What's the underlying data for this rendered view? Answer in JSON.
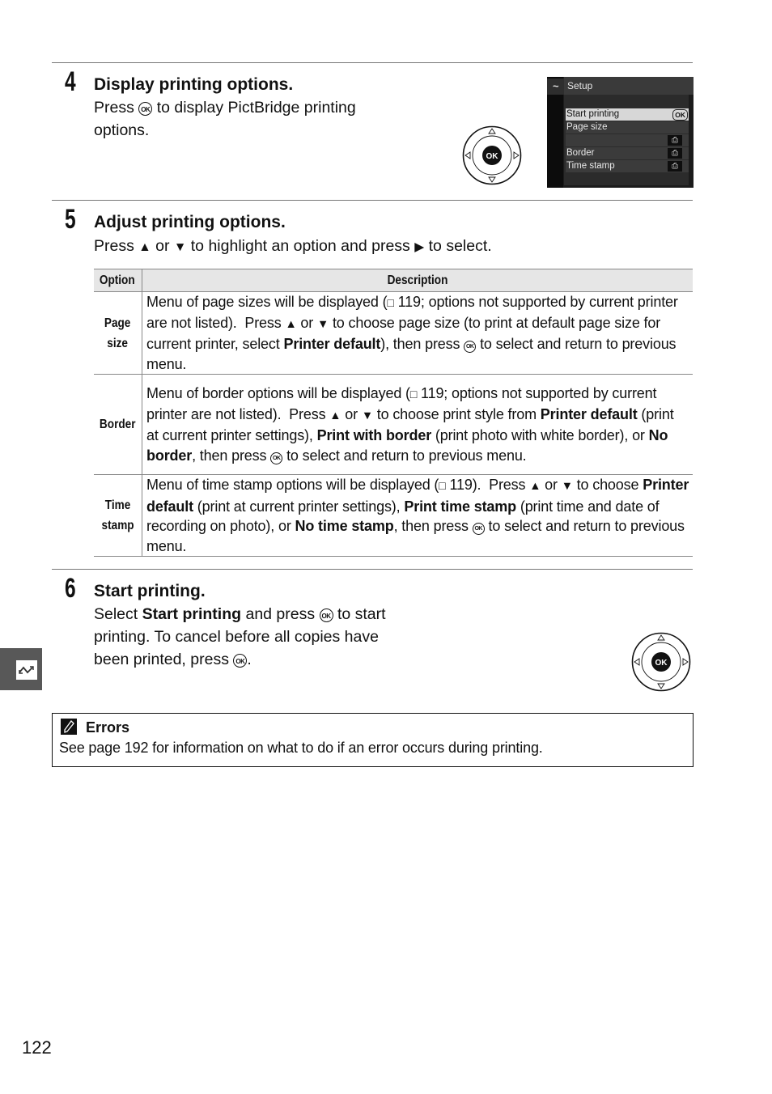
{
  "steps": [
    {
      "number": "4",
      "title": "Display printing options.",
      "body": {
        "pre": "Press",
        "ok": "OK",
        "post": "to display PictBridge printing",
        "line2": "options."
      }
    },
    {
      "number": "5",
      "title": "Adjust printing options.",
      "body": {
        "p1": "Press",
        "up": "▲",
        "p2": "or",
        "down": "▼",
        "p3": "to highlight an option and press",
        "right": "▶",
        "p4": "to select."
      }
    },
    {
      "number": "6",
      "title": "Start printing.",
      "body": {
        "l1_pre": "Select",
        "l1_bold": "Start printing",
        "l1_mid": "and press",
        "l1_post": "to start",
        "line2": "printing.  To cancel before all copies have",
        "l3_pre": "been printed, press",
        "l3_post": "."
      }
    }
  ],
  "camera_menu": {
    "header": "Setup",
    "tab_icon": "PictBridge",
    "items": [
      {
        "label": "Start printing",
        "value": "OK"
      },
      {
        "label": "Page size",
        "value": ""
      },
      {
        "label": "",
        "value": "printer-default"
      },
      {
        "label": "Border",
        "value": "printer-default"
      },
      {
        "label": "Time stamp",
        "value": "printer-default"
      }
    ]
  },
  "multi_selector": {
    "center_label": "OK"
  },
  "table": {
    "headers": [
      "Option",
      "Description"
    ],
    "rows": [
      {
        "option_l1": "Page",
        "option_l2": "size",
        "d": [
          "Menu of page sizes will be displayed (",
          "□",
          " 119; options not supported by current printer are not listed).  Press ",
          "▲",
          " or ",
          "▼",
          " to choose page size (to print at default page size for current printer, select ",
          "Printer default",
          "), then press ",
          "OK",
          " to select and return to previous menu."
        ]
      },
      {
        "option_l1": "Border",
        "option_l2": "",
        "d": [
          "Menu of border options will be displayed (",
          "□",
          " 119; options not supported by current printer are not listed).  Press ",
          "▲",
          " or ",
          "▼",
          " to choose print style from ",
          "Printer default",
          " (print at current printer settings), ",
          "Print with border",
          " (print photo with white border), or ",
          "No border",
          ", then press ",
          "OK",
          " to select and return to previous menu."
        ]
      },
      {
        "option_l1": "Time",
        "option_l2": "stamp",
        "d": [
          "Menu of time stamp options will be displayed (",
          "□",
          " 119).  Press ",
          "▲",
          " or ",
          "▼",
          " to choose ",
          "Printer default",
          " (print at current printer settings), ",
          "Print time stamp",
          " (print time and date of recording on photo), or ",
          "No time stamp",
          ", then press ",
          "OK",
          " to select and return to previous menu."
        ]
      }
    ]
  },
  "note": {
    "icon": "pencil-icon",
    "title": "Errors",
    "body": "See page 192 for information on what to do if an error occurs during printing."
  },
  "side_tab": {
    "icon": "connection-icon"
  },
  "page_number": "122"
}
